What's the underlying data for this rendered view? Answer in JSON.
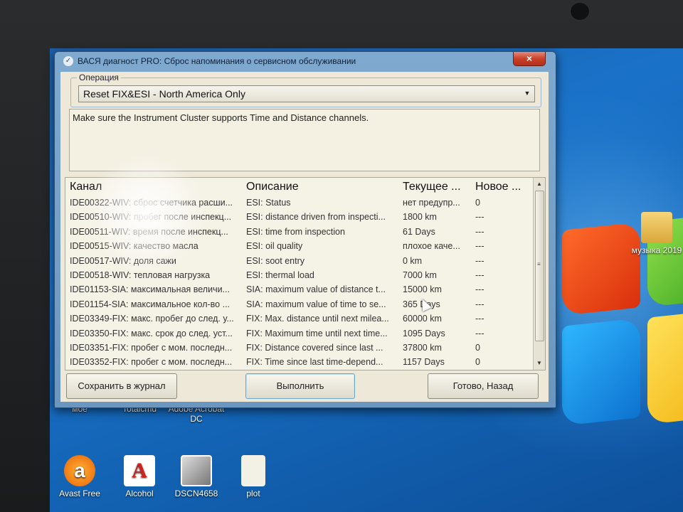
{
  "window": {
    "title": "ВАСЯ диагност PRO: Сброс напоминания о сервисном обслуживании",
    "close_label": "×"
  },
  "operation": {
    "group_label": "Операция",
    "selected": "Reset FIX&ESI - North America Only"
  },
  "note": "Make sure the Instrument Cluster supports Time and Distance channels.",
  "table": {
    "headers": [
      "Канал",
      "Описание",
      "Текущее ...",
      "Новое ..."
    ],
    "rows": [
      [
        "IDE00322-WIV: сброс счетчика расши...",
        "ESI: Status",
        "нет предупр...",
        "0"
      ],
      [
        "IDE00510-WIV: пробег после инспекц...",
        "ESI: distance driven from inspecti...",
        "1800 km",
        "---"
      ],
      [
        "IDE00511-WIV: время после инспекц...",
        "ESI: time from inspection",
        "61 Days",
        "---"
      ],
      [
        "IDE00515-WIV: качество масла",
        "ESI: oil quality",
        "плохое каче...",
        "---"
      ],
      [
        "IDE00517-WIV: доля сажи",
        "ESI: soot entry",
        "0 km",
        "---"
      ],
      [
        "IDE00518-WIV: тепловая нагрузка",
        "ESI: thermal load",
        "7000 km",
        "---"
      ],
      [
        "IDE01153-SIA: максимальная величи...",
        "SIA: maximum value of distance t...",
        "15000 km",
        "---"
      ],
      [
        "IDE01154-SIA: максимальное кол-во ...",
        "SIA: maximum value of time to se...",
        "365 Days",
        "---"
      ],
      [
        "IDE03349-FIX: макс. пробег до след. у...",
        "FIX: Max. distance until next milea...",
        "60000 km",
        "---"
      ],
      [
        "IDE03350-FIX: макс. срок до след. уст...",
        "FIX: Maximum time until next time...",
        "1095 Days",
        "---"
      ],
      [
        "IDE03351-FIX: пробег с мом. последн...",
        "FIX: Distance covered since last ...",
        "37800 km",
        "0"
      ],
      [
        "IDE03352-FIX: пробег с мом. последн...",
        "FIX: Time since last time-depend...",
        "1157 Days",
        "0"
      ]
    ]
  },
  "buttons": {
    "save": "Сохранить в журнал",
    "run": "Выполнить",
    "done": "Готово, Назад"
  },
  "desktop_icons": [
    {
      "label": "мое",
      "icon": "folder-icon"
    },
    {
      "label": "Totalcmd",
      "icon": "app-icon"
    },
    {
      "label": "Adobe Acrobat DC",
      "icon": "acrobat-icon"
    },
    {
      "label": "Avast Free",
      "icon": "avast-icon"
    },
    {
      "label": "Alcohol",
      "icon": "alcohol-icon"
    },
    {
      "label": "DSCN4658",
      "icon": "image-icon"
    },
    {
      "label": "plot",
      "icon": "file-icon"
    },
    {
      "label": "музыка 2019",
      "icon": "music-folder-icon"
    }
  ],
  "colors": {
    "accent": "#6b96bf",
    "close": "#c9412a",
    "desktop": "#1a72c8"
  }
}
